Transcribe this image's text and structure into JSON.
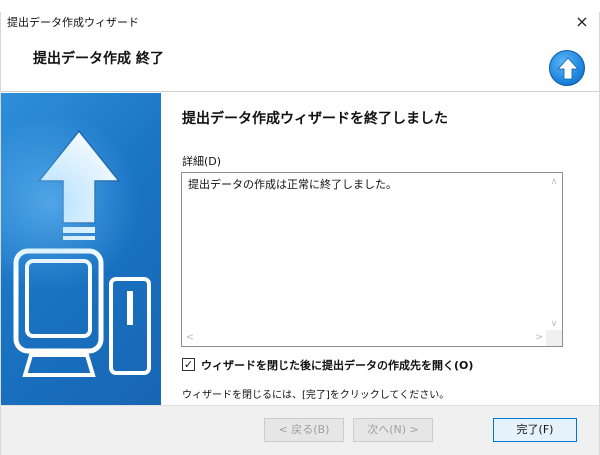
{
  "window": {
    "title": "提出データ作成ウィザード",
    "close_glyph": "×"
  },
  "header": {
    "title": "提出データ作成 終了"
  },
  "content": {
    "main_title": "提出データ作成ウィザードを終了しました",
    "detail_label": "詳細(D)",
    "detail_text": "提出データの作成は正常に終了しました。",
    "checkbox_checked": true,
    "checkbox_label": "ウィザードを閉じた後に提出データの作成先を開く(O)",
    "hint": "ウィザードを閉じるには、[完了]をクリックしてください。"
  },
  "footer": {
    "back_label": "< 戻る(B)",
    "next_label": "次へ(N) >",
    "finish_label": "完了(F)"
  },
  "colors": {
    "sidebar_blue": "#1a74c4",
    "accent": "#0078d7"
  }
}
